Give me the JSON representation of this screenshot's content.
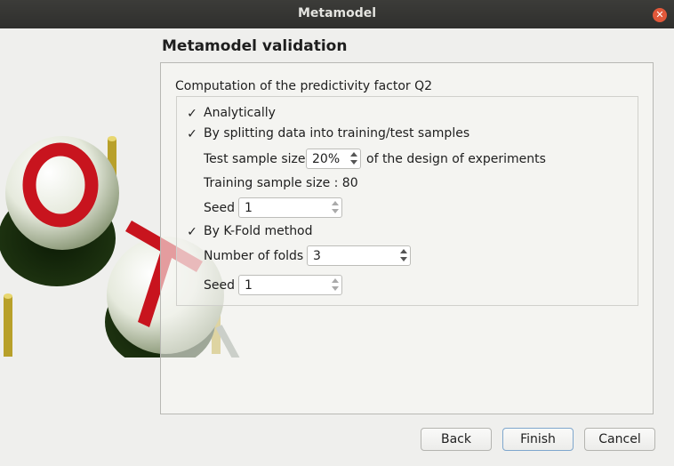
{
  "window": {
    "title": "Metamodel"
  },
  "page": {
    "title": "Metamodel validation"
  },
  "q2": {
    "label": "Computation of the predictivity factor Q2",
    "analytically": {
      "label": "Analytically",
      "mark": "✓"
    },
    "splitting": {
      "label": "By splitting data into training/test samples",
      "mark": "✓",
      "test_size_label": "Test sample size",
      "test_size_value": "20%",
      "test_size_suffix": "of the design of experiments",
      "training_size_text": "Training sample size : 80",
      "seed_label": "Seed",
      "seed_value": "1"
    },
    "kfold": {
      "label": "By K-Fold method",
      "mark": "✓",
      "folds_label": "Number of folds",
      "folds_value": "3",
      "seed_label": "Seed",
      "seed_value": "1"
    }
  },
  "buttons": {
    "back": "Back",
    "finish": "Finish",
    "cancel": "Cancel"
  },
  "icons": {
    "close": "close-icon",
    "logo": "openturns-logo"
  },
  "colors": {
    "titlebar": "#2f2f2d",
    "close": "#e2583a",
    "logo_red": "#c8141e",
    "logo_gold": "#b8a02a"
  }
}
